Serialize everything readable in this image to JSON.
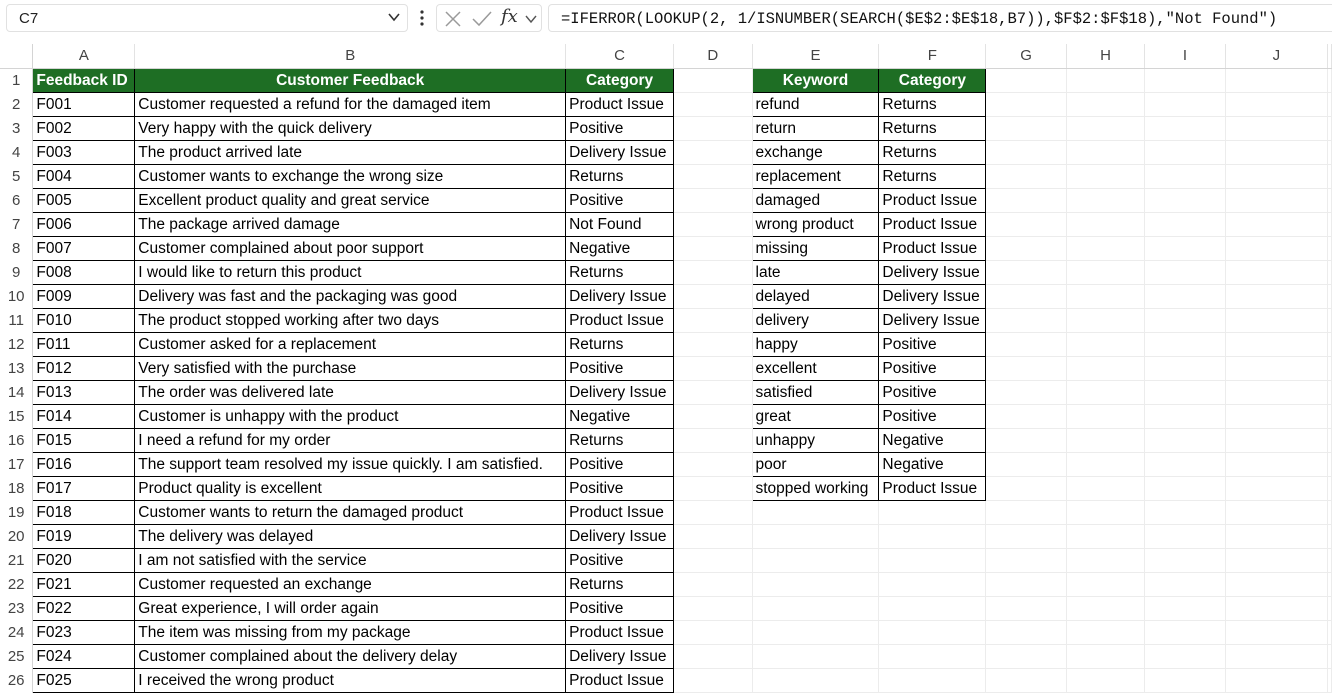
{
  "name_box": "C7",
  "formula": "=IFERROR(LOOKUP(2, 1/ISNUMBER(SEARCH($E$2:$E$18,B7)),$F$2:$F$18),\"Not Found\")",
  "column_headers": [
    "A",
    "B",
    "C",
    "D",
    "E",
    "F",
    "G",
    "H",
    "I",
    "J"
  ],
  "row_numbers": [
    "1",
    "2",
    "3",
    "4",
    "5",
    "6",
    "7",
    "8",
    "9",
    "10",
    "11",
    "12",
    "13",
    "14",
    "15",
    "16",
    "17",
    "18",
    "19",
    "20",
    "21",
    "22",
    "23",
    "24",
    "25",
    "26"
  ],
  "feedback_table": {
    "headers": [
      "Feedback ID",
      "Customer Feedback",
      "Category"
    ],
    "rows": [
      [
        "F001",
        "Customer requested a refund for the damaged item",
        "Product Issue"
      ],
      [
        "F002",
        "Very happy with the quick delivery",
        "Positive"
      ],
      [
        "F003",
        "The product arrived late",
        "Delivery Issue"
      ],
      [
        "F004",
        "Customer wants to exchange the wrong size",
        "Returns"
      ],
      [
        "F005",
        "Excellent product quality and great service",
        "Positive"
      ],
      [
        "F006",
        "The package arrived damage",
        "Not Found"
      ],
      [
        "F007",
        "Customer complained about poor support",
        "Negative"
      ],
      [
        "F008",
        "I would like to return this product",
        "Returns"
      ],
      [
        "F009",
        "Delivery was fast and the packaging was good",
        "Delivery Issue"
      ],
      [
        "F010",
        "The product stopped working after two days",
        "Product Issue"
      ],
      [
        "F011",
        "Customer asked for a replacement",
        "Returns"
      ],
      [
        "F012",
        "Very satisfied with the purchase",
        "Positive"
      ],
      [
        "F013",
        "The order was delivered late",
        "Delivery Issue"
      ],
      [
        "F014",
        "Customer is unhappy with the product",
        "Negative"
      ],
      [
        "F015",
        "I need a refund for my order",
        "Returns"
      ],
      [
        "F016",
        "The support team resolved my issue quickly. I am satisfied.",
        "Positive"
      ],
      [
        "F017",
        "Product quality is excellent",
        "Positive"
      ],
      [
        "F018",
        "Customer wants to return the damaged product",
        "Product Issue"
      ],
      [
        "F019",
        "The delivery was delayed",
        "Delivery Issue"
      ],
      [
        "F020",
        "I am not satisfied with the service",
        "Positive"
      ],
      [
        "F021",
        "Customer requested an exchange",
        "Returns"
      ],
      [
        "F022",
        "Great experience, I will order again",
        "Positive"
      ],
      [
        "F023",
        "The item was missing from my package",
        "Product Issue"
      ],
      [
        "F024",
        "Customer complained about the delivery delay",
        "Delivery Issue"
      ],
      [
        "F025",
        "I received the wrong product",
        "Product Issue"
      ]
    ]
  },
  "keyword_table": {
    "headers": [
      "Keyword",
      "Category"
    ],
    "rows": [
      [
        "refund",
        "Returns"
      ],
      [
        "return",
        "Returns"
      ],
      [
        "exchange",
        "Returns"
      ],
      [
        "replacement",
        "Returns"
      ],
      [
        "damaged",
        "Product Issue"
      ],
      [
        "wrong product",
        "Product Issue"
      ],
      [
        "missing",
        "Product Issue"
      ],
      [
        "late",
        "Delivery Issue"
      ],
      [
        "delayed",
        "Delivery Issue"
      ],
      [
        "delivery",
        "Delivery Issue"
      ],
      [
        "happy",
        "Positive"
      ],
      [
        "excellent",
        "Positive"
      ],
      [
        "satisfied",
        "Positive"
      ],
      [
        "great",
        "Positive"
      ],
      [
        "unhappy",
        "Negative"
      ],
      [
        "poor",
        "Negative"
      ],
      [
        "stopped working",
        "Product Issue"
      ]
    ]
  },
  "colors": {
    "header_fill": "#1e6e24",
    "header_text": "#ffffff"
  },
  "icons": [
    "chevron-down-icon",
    "more-vertical-icon",
    "cancel-icon",
    "enter-icon",
    "function-icon"
  ]
}
